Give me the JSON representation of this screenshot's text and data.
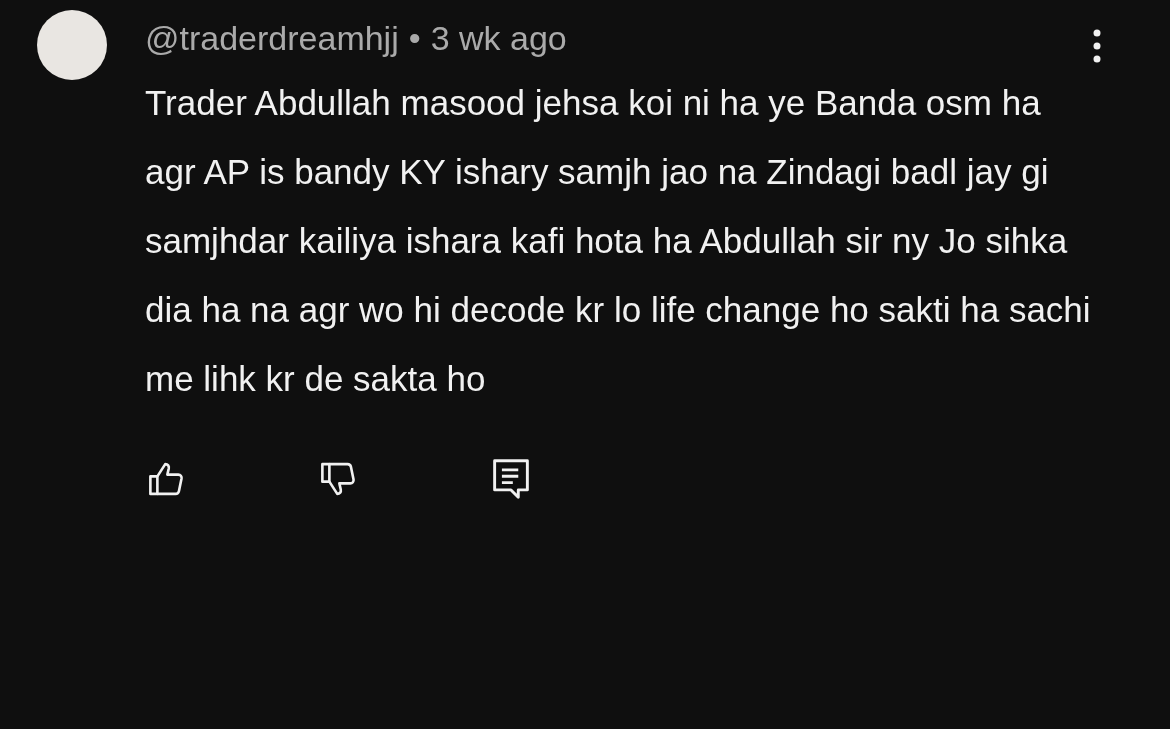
{
  "comment": {
    "author": "@traderdreamhjj",
    "separator": "•",
    "time": "3 wk ago",
    "text": "Trader Abdullah masood jehsa koi ni ha ye Banda osm ha agr AP is bandy KY ishary samjh jao na Zindagi badl jay gi samjhdar kailiya ishara kafi hota ha Abdullah sir ny Jo sihka dia ha na agr wo hi decode kr lo life change ho sakti ha sachi me lihk kr de sakta ho"
  }
}
